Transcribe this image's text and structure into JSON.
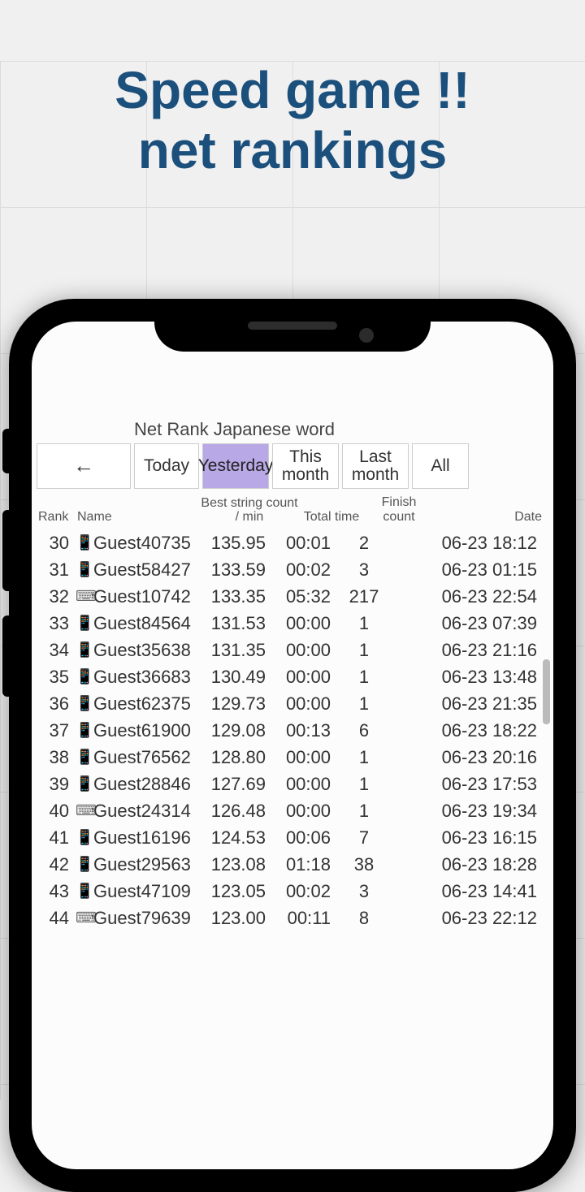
{
  "promo": {
    "line1": "Speed game !!",
    "line2": "net rankings"
  },
  "screen_title": "Net Rank Japanese word",
  "toolbar": {
    "back": "←",
    "tabs": [
      {
        "label": "Today",
        "active": false
      },
      {
        "label": "Yesterday",
        "active": true
      },
      {
        "label": "This month",
        "active": false
      },
      {
        "label": "Last month",
        "active": false
      },
      {
        "label": "All",
        "active": false
      }
    ]
  },
  "columns": {
    "rank": "Rank",
    "name": "Name",
    "best": "Best string count / min",
    "total": "Total time",
    "finish": "Finish count",
    "date": "Date"
  },
  "rows": [
    {
      "rank": 30,
      "icon": "phone",
      "name": "Guest40735",
      "best": "135.95",
      "total": "00:01",
      "finish": 2,
      "date": "06-23 18:12"
    },
    {
      "rank": 31,
      "icon": "phone",
      "name": "Guest58427",
      "best": "133.59",
      "total": "00:02",
      "finish": 3,
      "date": "06-23 01:15"
    },
    {
      "rank": 32,
      "icon": "pc",
      "name": "Guest10742",
      "best": "133.35",
      "total": "05:32",
      "finish": 217,
      "date": "06-23 22:54"
    },
    {
      "rank": 33,
      "icon": "phone",
      "name": "Guest84564",
      "best": "131.53",
      "total": "00:00",
      "finish": 1,
      "date": "06-23 07:39"
    },
    {
      "rank": 34,
      "icon": "phone",
      "name": "Guest35638",
      "best": "131.35",
      "total": "00:00",
      "finish": 1,
      "date": "06-23 21:16"
    },
    {
      "rank": 35,
      "icon": "phone",
      "name": "Guest36683",
      "best": "130.49",
      "total": "00:00",
      "finish": 1,
      "date": "06-23 13:48"
    },
    {
      "rank": 36,
      "icon": "phone",
      "name": "Guest62375",
      "best": "129.73",
      "total": "00:00",
      "finish": 1,
      "date": "06-23 21:35"
    },
    {
      "rank": 37,
      "icon": "phone",
      "name": "Guest61900",
      "best": "129.08",
      "total": "00:13",
      "finish": 6,
      "date": "06-23 18:22"
    },
    {
      "rank": 38,
      "icon": "phone",
      "name": "Guest76562",
      "best": "128.80",
      "total": "00:00",
      "finish": 1,
      "date": "06-23 20:16"
    },
    {
      "rank": 39,
      "icon": "phone",
      "name": "Guest28846",
      "best": "127.69",
      "total": "00:00",
      "finish": 1,
      "date": "06-23 17:53"
    },
    {
      "rank": 40,
      "icon": "pc",
      "name": "Guest24314",
      "best": "126.48",
      "total": "00:00",
      "finish": 1,
      "date": "06-23 19:34"
    },
    {
      "rank": 41,
      "icon": "phone",
      "name": "Guest16196",
      "best": "124.53",
      "total": "00:06",
      "finish": 7,
      "date": "06-23 16:15"
    },
    {
      "rank": 42,
      "icon": "phone",
      "name": "Guest29563",
      "best": "123.08",
      "total": "01:18",
      "finish": 38,
      "date": "06-23 18:28"
    },
    {
      "rank": 43,
      "icon": "phone",
      "name": "Guest47109",
      "best": "123.05",
      "total": "00:02",
      "finish": 3,
      "date": "06-23 14:41"
    },
    {
      "rank": 44,
      "icon": "pc",
      "name": "Guest79639",
      "best": "123.00",
      "total": "00:11",
      "finish": 8,
      "date": "06-23 22:12"
    }
  ],
  "icons": {
    "phone_glyph": "📱",
    "pc_glyph": "⌨"
  }
}
